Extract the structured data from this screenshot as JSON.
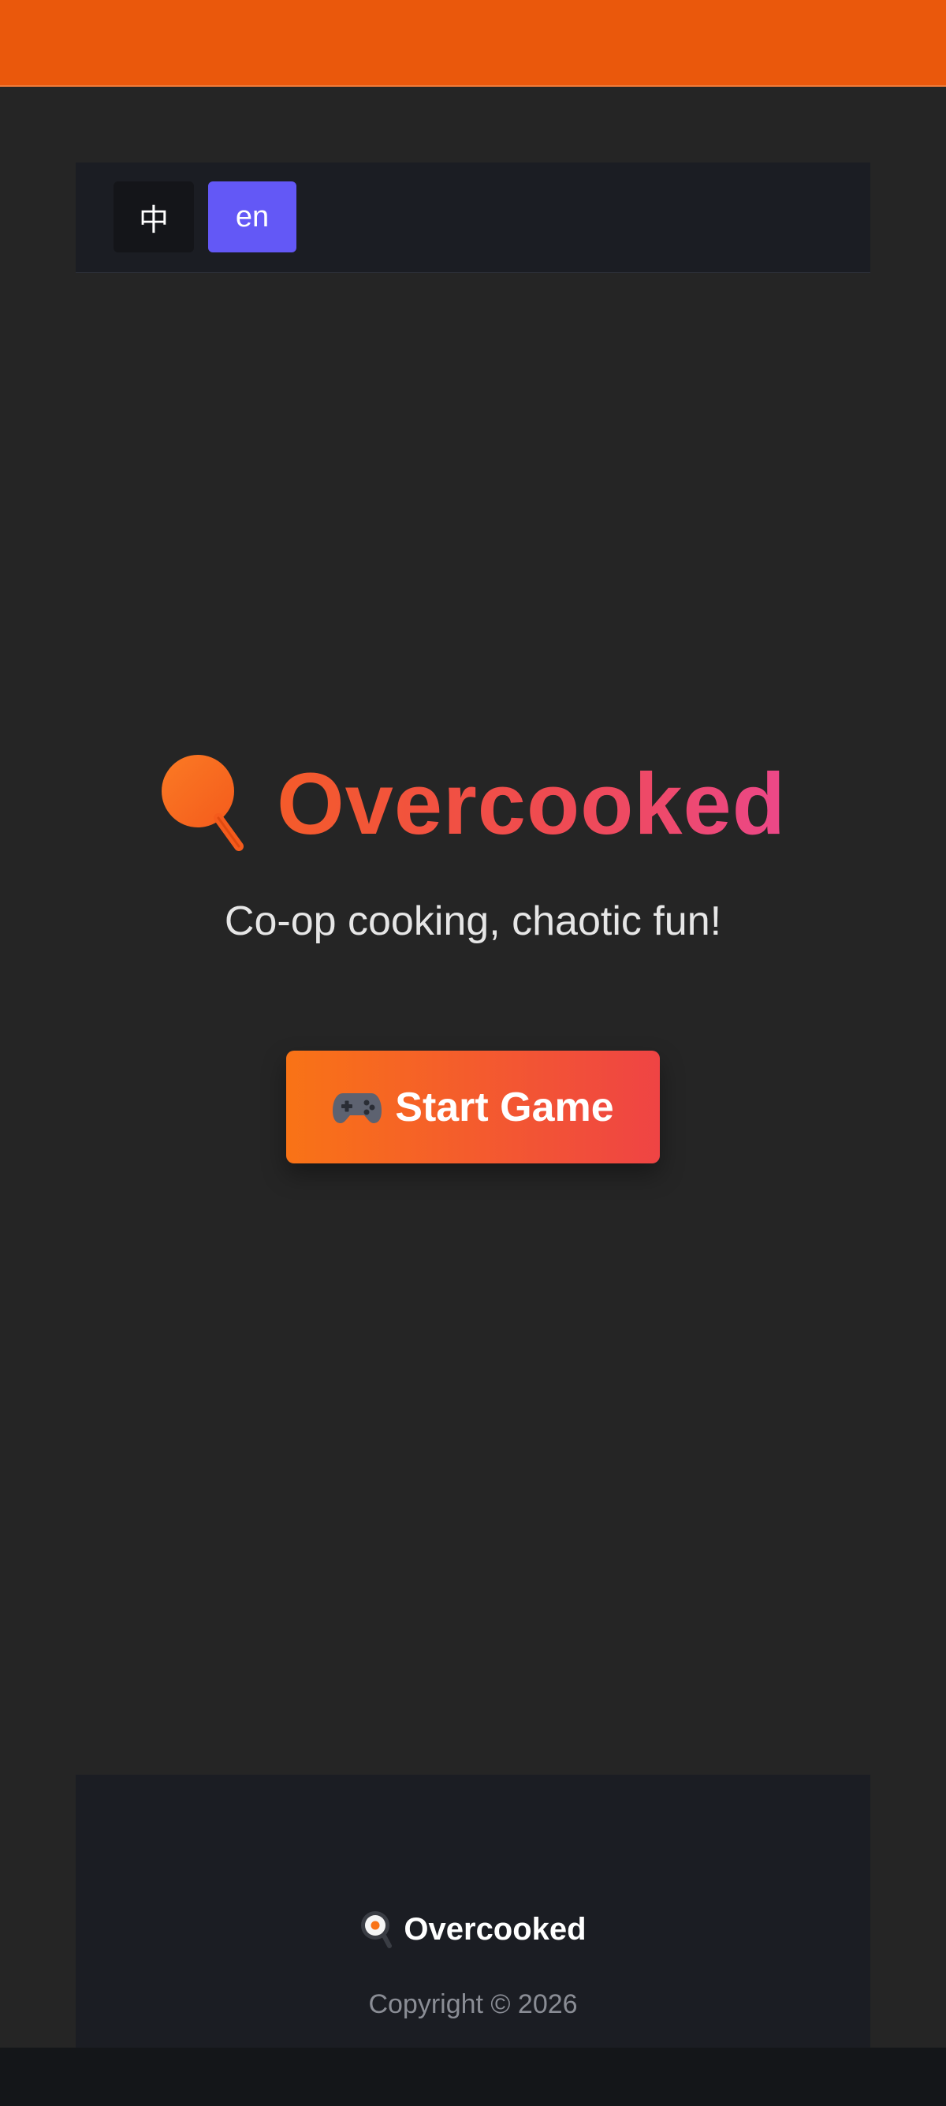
{
  "language_switcher": {
    "zh_label": "中",
    "en_label": "en",
    "active": "en"
  },
  "hero": {
    "title": "Overcooked",
    "tagline": "Co-op cooking, chaotic fun!",
    "title_icon": "frying-pan-icon"
  },
  "start_button": {
    "label": "Start Game",
    "icon": "gamepad-icon"
  },
  "footer": {
    "brand": "Overcooked",
    "brand_icon": "frying-pan-egg-icon",
    "copyright": "Copyright © 2026"
  },
  "colors": {
    "top_bar": "#ea580c",
    "active_language": "#6358f6",
    "title_gradient_start": "#f45b2a",
    "title_gradient_end": "#ec4889",
    "button_gradient_start": "#f97316",
    "button_gradient_end": "#ef4444",
    "page_background": "#252525"
  }
}
